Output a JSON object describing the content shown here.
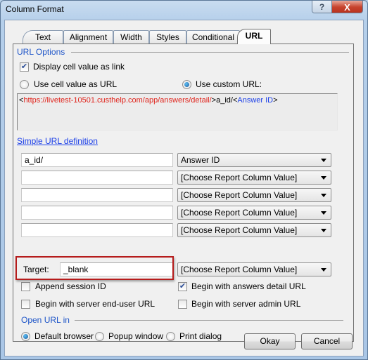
{
  "window": {
    "title": "Column Format",
    "help_label": "?",
    "close_label": "X"
  },
  "tabs": [
    {
      "label": "Text",
      "active": false
    },
    {
      "label": "Alignment",
      "active": false
    },
    {
      "label": "Width",
      "active": false
    },
    {
      "label": "Styles",
      "active": false
    },
    {
      "label": "Conditional",
      "active": false
    },
    {
      "label": "URL",
      "active": true
    }
  ],
  "url_options": {
    "group_label": "URL Options",
    "display_as_link": {
      "label": "Display cell value as link",
      "checked": true
    },
    "use_cell_value": {
      "label": "Use cell value as URL",
      "selected": false
    },
    "use_custom_url": {
      "label": "Use custom URL:",
      "selected": true
    },
    "custom_url": {
      "open1": "<",
      "base_url": "https://livetest-10501.custhelp.com/app/answers/detail/",
      "close1": ">",
      "literal": "a_id/",
      "open2": "<",
      "column": "Answer ID",
      "close2": ">"
    },
    "simple_url_link": "Simple URL definition",
    "rows": [
      {
        "text": "a_id/",
        "column": "Answer ID"
      },
      {
        "text": "",
        "column": "[Choose Report Column Value]"
      },
      {
        "text": "",
        "column": "[Choose Report Column Value]"
      },
      {
        "text": "",
        "column": "[Choose Report Column Value]"
      },
      {
        "text": "",
        "column": "[Choose Report Column Value]"
      }
    ],
    "target_label": "Target:",
    "target_value": "_blank",
    "target_column": "[Choose Report Column Value]",
    "append_session_id": {
      "label": "Append session ID",
      "checked": false
    },
    "begin_answers_detail": {
      "label": "Begin with answers detail URL",
      "checked": true
    },
    "begin_server_enduser": {
      "label": "Begin with server end-user URL",
      "checked": false
    },
    "begin_server_admin": {
      "label": "Begin with server admin URL",
      "checked": false
    }
  },
  "open_url_in": {
    "group_label": "Open URL in",
    "options": [
      {
        "label": "Default browser",
        "selected": true
      },
      {
        "label": "Popup window",
        "selected": false
      },
      {
        "label": "Print dialog",
        "selected": false
      }
    ]
  },
  "buttons": {
    "okay": "Okay",
    "cancel": "Cancel"
  }
}
